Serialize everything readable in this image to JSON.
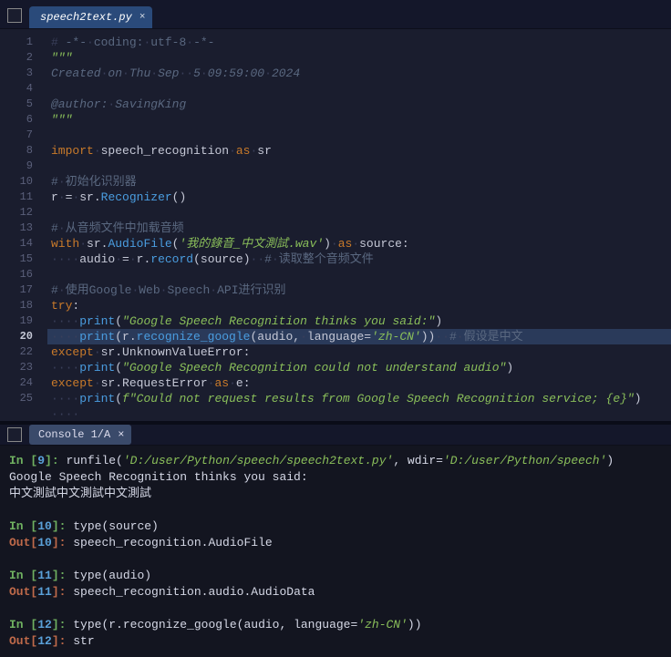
{
  "editor": {
    "tab": {
      "label": "speech2text.py"
    },
    "lines": [
      {
        "n": "1",
        "seg": [
          {
            "t": "ws",
            "v": "# "
          },
          {
            "t": "cm",
            "v": "-*-"
          },
          {
            "t": "ws",
            "v": "·"
          },
          {
            "t": "cm",
            "v": "coding:"
          },
          {
            "t": "ws",
            "v": "·"
          },
          {
            "t": "cm",
            "v": "utf-8"
          },
          {
            "t": "ws",
            "v": "·"
          },
          {
            "t": "cm",
            "v": "-*-"
          }
        ]
      },
      {
        "n": "2",
        "seg": [
          {
            "t": "st",
            "v": "\"\"\""
          }
        ]
      },
      {
        "n": "3",
        "seg": [
          {
            "t": "cmi",
            "v": "Created"
          },
          {
            "t": "ws",
            "v": "·"
          },
          {
            "t": "cmi",
            "v": "on"
          },
          {
            "t": "ws",
            "v": "·"
          },
          {
            "t": "cmi",
            "v": "Thu"
          },
          {
            "t": "ws",
            "v": "·"
          },
          {
            "t": "cmi",
            "v": "Sep"
          },
          {
            "t": "ws",
            "v": "··"
          },
          {
            "t": "cmi",
            "v": "5"
          },
          {
            "t": "ws",
            "v": "·"
          },
          {
            "t": "cmi",
            "v": "09:59:00"
          },
          {
            "t": "ws",
            "v": "·"
          },
          {
            "t": "cmi",
            "v": "2024"
          }
        ]
      },
      {
        "n": "4",
        "seg": []
      },
      {
        "n": "5",
        "seg": [
          {
            "t": "cmi",
            "v": "@author:"
          },
          {
            "t": "ws",
            "v": "·"
          },
          {
            "t": "cmi",
            "v": "SavingKing"
          }
        ]
      },
      {
        "n": "6",
        "seg": [
          {
            "t": "st",
            "v": "\"\"\""
          }
        ]
      },
      {
        "n": "7",
        "seg": []
      },
      {
        "n": "8",
        "seg": [
          {
            "t": "kw",
            "v": "import"
          },
          {
            "t": "ws",
            "v": "·"
          },
          {
            "t": "pn",
            "v": "speech_recognition"
          },
          {
            "t": "ws",
            "v": "·"
          },
          {
            "t": "kw",
            "v": "as"
          },
          {
            "t": "ws",
            "v": "·"
          },
          {
            "t": "pn",
            "v": "sr"
          }
        ]
      },
      {
        "n": "9",
        "seg": []
      },
      {
        "n": "10",
        "seg": [
          {
            "t": "cm",
            "v": "#"
          },
          {
            "t": "ws",
            "v": "·"
          },
          {
            "t": "cm",
            "v": "初始化识别器"
          }
        ]
      },
      {
        "n": "11",
        "seg": [
          {
            "t": "pn",
            "v": "r"
          },
          {
            "t": "ws",
            "v": "·"
          },
          {
            "t": "pn",
            "v": "="
          },
          {
            "t": "ws",
            "v": "·"
          },
          {
            "t": "pn",
            "v": "sr."
          },
          {
            "t": "fn",
            "v": "Recognizer"
          },
          {
            "t": "pn",
            "v": "()"
          }
        ]
      },
      {
        "n": "12",
        "seg": []
      },
      {
        "n": "13",
        "seg": [
          {
            "t": "cm",
            "v": "#"
          },
          {
            "t": "ws",
            "v": "·"
          },
          {
            "t": "cm",
            "v": "从音频文件中加载音频"
          }
        ]
      },
      {
        "n": "14",
        "seg": [
          {
            "t": "kw",
            "v": "with"
          },
          {
            "t": "ws",
            "v": "·"
          },
          {
            "t": "pn",
            "v": "sr."
          },
          {
            "t": "fn",
            "v": "AudioFile"
          },
          {
            "t": "pn",
            "v": "("
          },
          {
            "t": "st",
            "v": "'我的錄音_中文測試.wav'"
          },
          {
            "t": "pn",
            "v": ")"
          },
          {
            "t": "ws",
            "v": "·"
          },
          {
            "t": "kw",
            "v": "as"
          },
          {
            "t": "ws",
            "v": "·"
          },
          {
            "t": "pn",
            "v": "source:"
          }
        ]
      },
      {
        "n": "15",
        "seg": [
          {
            "t": "ws",
            "v": "····"
          },
          {
            "t": "pn",
            "v": "audio"
          },
          {
            "t": "ws",
            "v": "·"
          },
          {
            "t": "pn",
            "v": "="
          },
          {
            "t": "ws",
            "v": "·"
          },
          {
            "t": "pn",
            "v": "r."
          },
          {
            "t": "fn",
            "v": "record"
          },
          {
            "t": "pn",
            "v": "(source)"
          },
          {
            "t": "ws",
            "v": "··"
          },
          {
            "t": "cm",
            "v": "#"
          },
          {
            "t": "ws",
            "v": "·"
          },
          {
            "t": "cm",
            "v": "读取整个音频文件"
          }
        ]
      },
      {
        "n": "16",
        "seg": []
      },
      {
        "n": "17",
        "seg": [
          {
            "t": "cm",
            "v": "#"
          },
          {
            "t": "ws",
            "v": "·"
          },
          {
            "t": "cm",
            "v": "使用Google"
          },
          {
            "t": "ws",
            "v": "·"
          },
          {
            "t": "cm",
            "v": "Web"
          },
          {
            "t": "ws",
            "v": "·"
          },
          {
            "t": "cm",
            "v": "Speech"
          },
          {
            "t": "ws",
            "v": "·"
          },
          {
            "t": "cm",
            "v": "API进行识别"
          }
        ]
      },
      {
        "n": "18",
        "seg": [
          {
            "t": "kw",
            "v": "try"
          },
          {
            "t": "pn",
            "v": ":"
          }
        ]
      },
      {
        "n": "19",
        "seg": [
          {
            "t": "ws",
            "v": "····"
          },
          {
            "t": "bn",
            "v": "print"
          },
          {
            "t": "pn",
            "v": "("
          },
          {
            "t": "st",
            "v": "\"Google Speech Recognition thinks you said:\""
          },
          {
            "t": "pn",
            "v": ")"
          }
        ]
      },
      {
        "n": "20",
        "hl": true,
        "seg": [
          {
            "t": "ws",
            "v": "····"
          },
          {
            "t": "bn",
            "v": "print"
          },
          {
            "t": "pn",
            "v": "(r."
          },
          {
            "t": "fn",
            "v": "recognize_google"
          },
          {
            "t": "pn",
            "v": "(audio,"
          },
          {
            "t": "ws",
            "v": "·"
          },
          {
            "t": "pn",
            "v": "language="
          },
          {
            "t": "st",
            "v": "'zh-CN'"
          },
          {
            "t": "pn",
            "v": "))"
          },
          {
            "t": "ws",
            "v": "··"
          },
          {
            "t": "cm",
            "v": "#"
          },
          {
            "t": "ws",
            "v": "·"
          },
          {
            "t": "cm",
            "v": "假设是中文"
          }
        ]
      },
      {
        "n": "22",
        "seg": [
          {
            "t": "kw",
            "v": "except"
          },
          {
            "t": "ws",
            "v": "·"
          },
          {
            "t": "pn",
            "v": "sr.UnknownValueError:"
          }
        ]
      },
      {
        "n": "23",
        "seg": [
          {
            "t": "ws",
            "v": "····"
          },
          {
            "t": "bn",
            "v": "print"
          },
          {
            "t": "pn",
            "v": "("
          },
          {
            "t": "st",
            "v": "\"Google Speech Recognition could not understand audio\""
          },
          {
            "t": "pn",
            "v": ")"
          }
        ]
      },
      {
        "n": "24",
        "seg": [
          {
            "t": "kw",
            "v": "except"
          },
          {
            "t": "ws",
            "v": "·"
          },
          {
            "t": "pn",
            "v": "sr.RequestError"
          },
          {
            "t": "ws",
            "v": "·"
          },
          {
            "t": "kw",
            "v": "as"
          },
          {
            "t": "ws",
            "v": "·"
          },
          {
            "t": "pn",
            "v": "e:"
          }
        ]
      },
      {
        "n": "25",
        "seg": [
          {
            "t": "ws",
            "v": "····"
          },
          {
            "t": "bn",
            "v": "print"
          },
          {
            "t": "pn",
            "v": "("
          },
          {
            "t": "st",
            "v": "f\"Could not request results from Google Speech Recognition service; {e}\""
          },
          {
            "t": "pn",
            "v": ")"
          }
        ]
      },
      {
        "n": "",
        "seg": [
          {
            "t": "ws",
            "v": "····"
          }
        ]
      }
    ],
    "current_big": "20"
  },
  "console": {
    "tab": "Console 1/A",
    "lines": [
      {
        "seg": [
          {
            "t": "pr-in",
            "v": "In ["
          },
          {
            "t": "pr-num",
            "v": "9"
          },
          {
            "t": "pr-in",
            "v": "]: "
          },
          {
            "t": "pr-txt",
            "v": "runfile("
          },
          {
            "t": "pr-str",
            "v": "'D:/user/Python/speech/speech2text.py'"
          },
          {
            "t": "pr-txt",
            "v": ", wdir="
          },
          {
            "t": "pr-str",
            "v": "'D:/user/Python/speech'"
          },
          {
            "t": "pr-txt",
            "v": ")"
          }
        ]
      },
      {
        "seg": [
          {
            "t": "pr-txt",
            "v": "Google Speech Recognition thinks you said:"
          }
        ]
      },
      {
        "seg": [
          {
            "t": "pr-txt",
            "v": "中文測試中文測試中文測試"
          }
        ]
      },
      {
        "seg": []
      },
      {
        "seg": [
          {
            "t": "pr-in",
            "v": "In ["
          },
          {
            "t": "pr-num",
            "v": "10"
          },
          {
            "t": "pr-in",
            "v": "]: "
          },
          {
            "t": "pr-txt",
            "v": "type(source)"
          }
        ]
      },
      {
        "seg": [
          {
            "t": "pr-out",
            "v": "Out["
          },
          {
            "t": "pr-num",
            "v": "10"
          },
          {
            "t": "pr-out",
            "v": "]: "
          },
          {
            "t": "pr-txt",
            "v": "speech_recognition.AudioFile"
          }
        ]
      },
      {
        "seg": []
      },
      {
        "seg": [
          {
            "t": "pr-in",
            "v": "In ["
          },
          {
            "t": "pr-num",
            "v": "11"
          },
          {
            "t": "pr-in",
            "v": "]: "
          },
          {
            "t": "pr-txt",
            "v": "type(audio)"
          }
        ]
      },
      {
        "seg": [
          {
            "t": "pr-out",
            "v": "Out["
          },
          {
            "t": "pr-num",
            "v": "11"
          },
          {
            "t": "pr-out",
            "v": "]: "
          },
          {
            "t": "pr-txt",
            "v": "speech_recognition.audio.AudioData"
          }
        ]
      },
      {
        "seg": []
      },
      {
        "seg": [
          {
            "t": "pr-in",
            "v": "In ["
          },
          {
            "t": "pr-num",
            "v": "12"
          },
          {
            "t": "pr-in",
            "v": "]: "
          },
          {
            "t": "pr-txt",
            "v": "type(r.recognize_google(audio, language="
          },
          {
            "t": "pr-str",
            "v": "'zh-CN'"
          },
          {
            "t": "pr-txt",
            "v": "))"
          }
        ]
      },
      {
        "seg": [
          {
            "t": "pr-out",
            "v": "Out["
          },
          {
            "t": "pr-num",
            "v": "12"
          },
          {
            "t": "pr-out",
            "v": "]: "
          },
          {
            "t": "pr-txt",
            "v": "str"
          }
        ]
      }
    ]
  }
}
